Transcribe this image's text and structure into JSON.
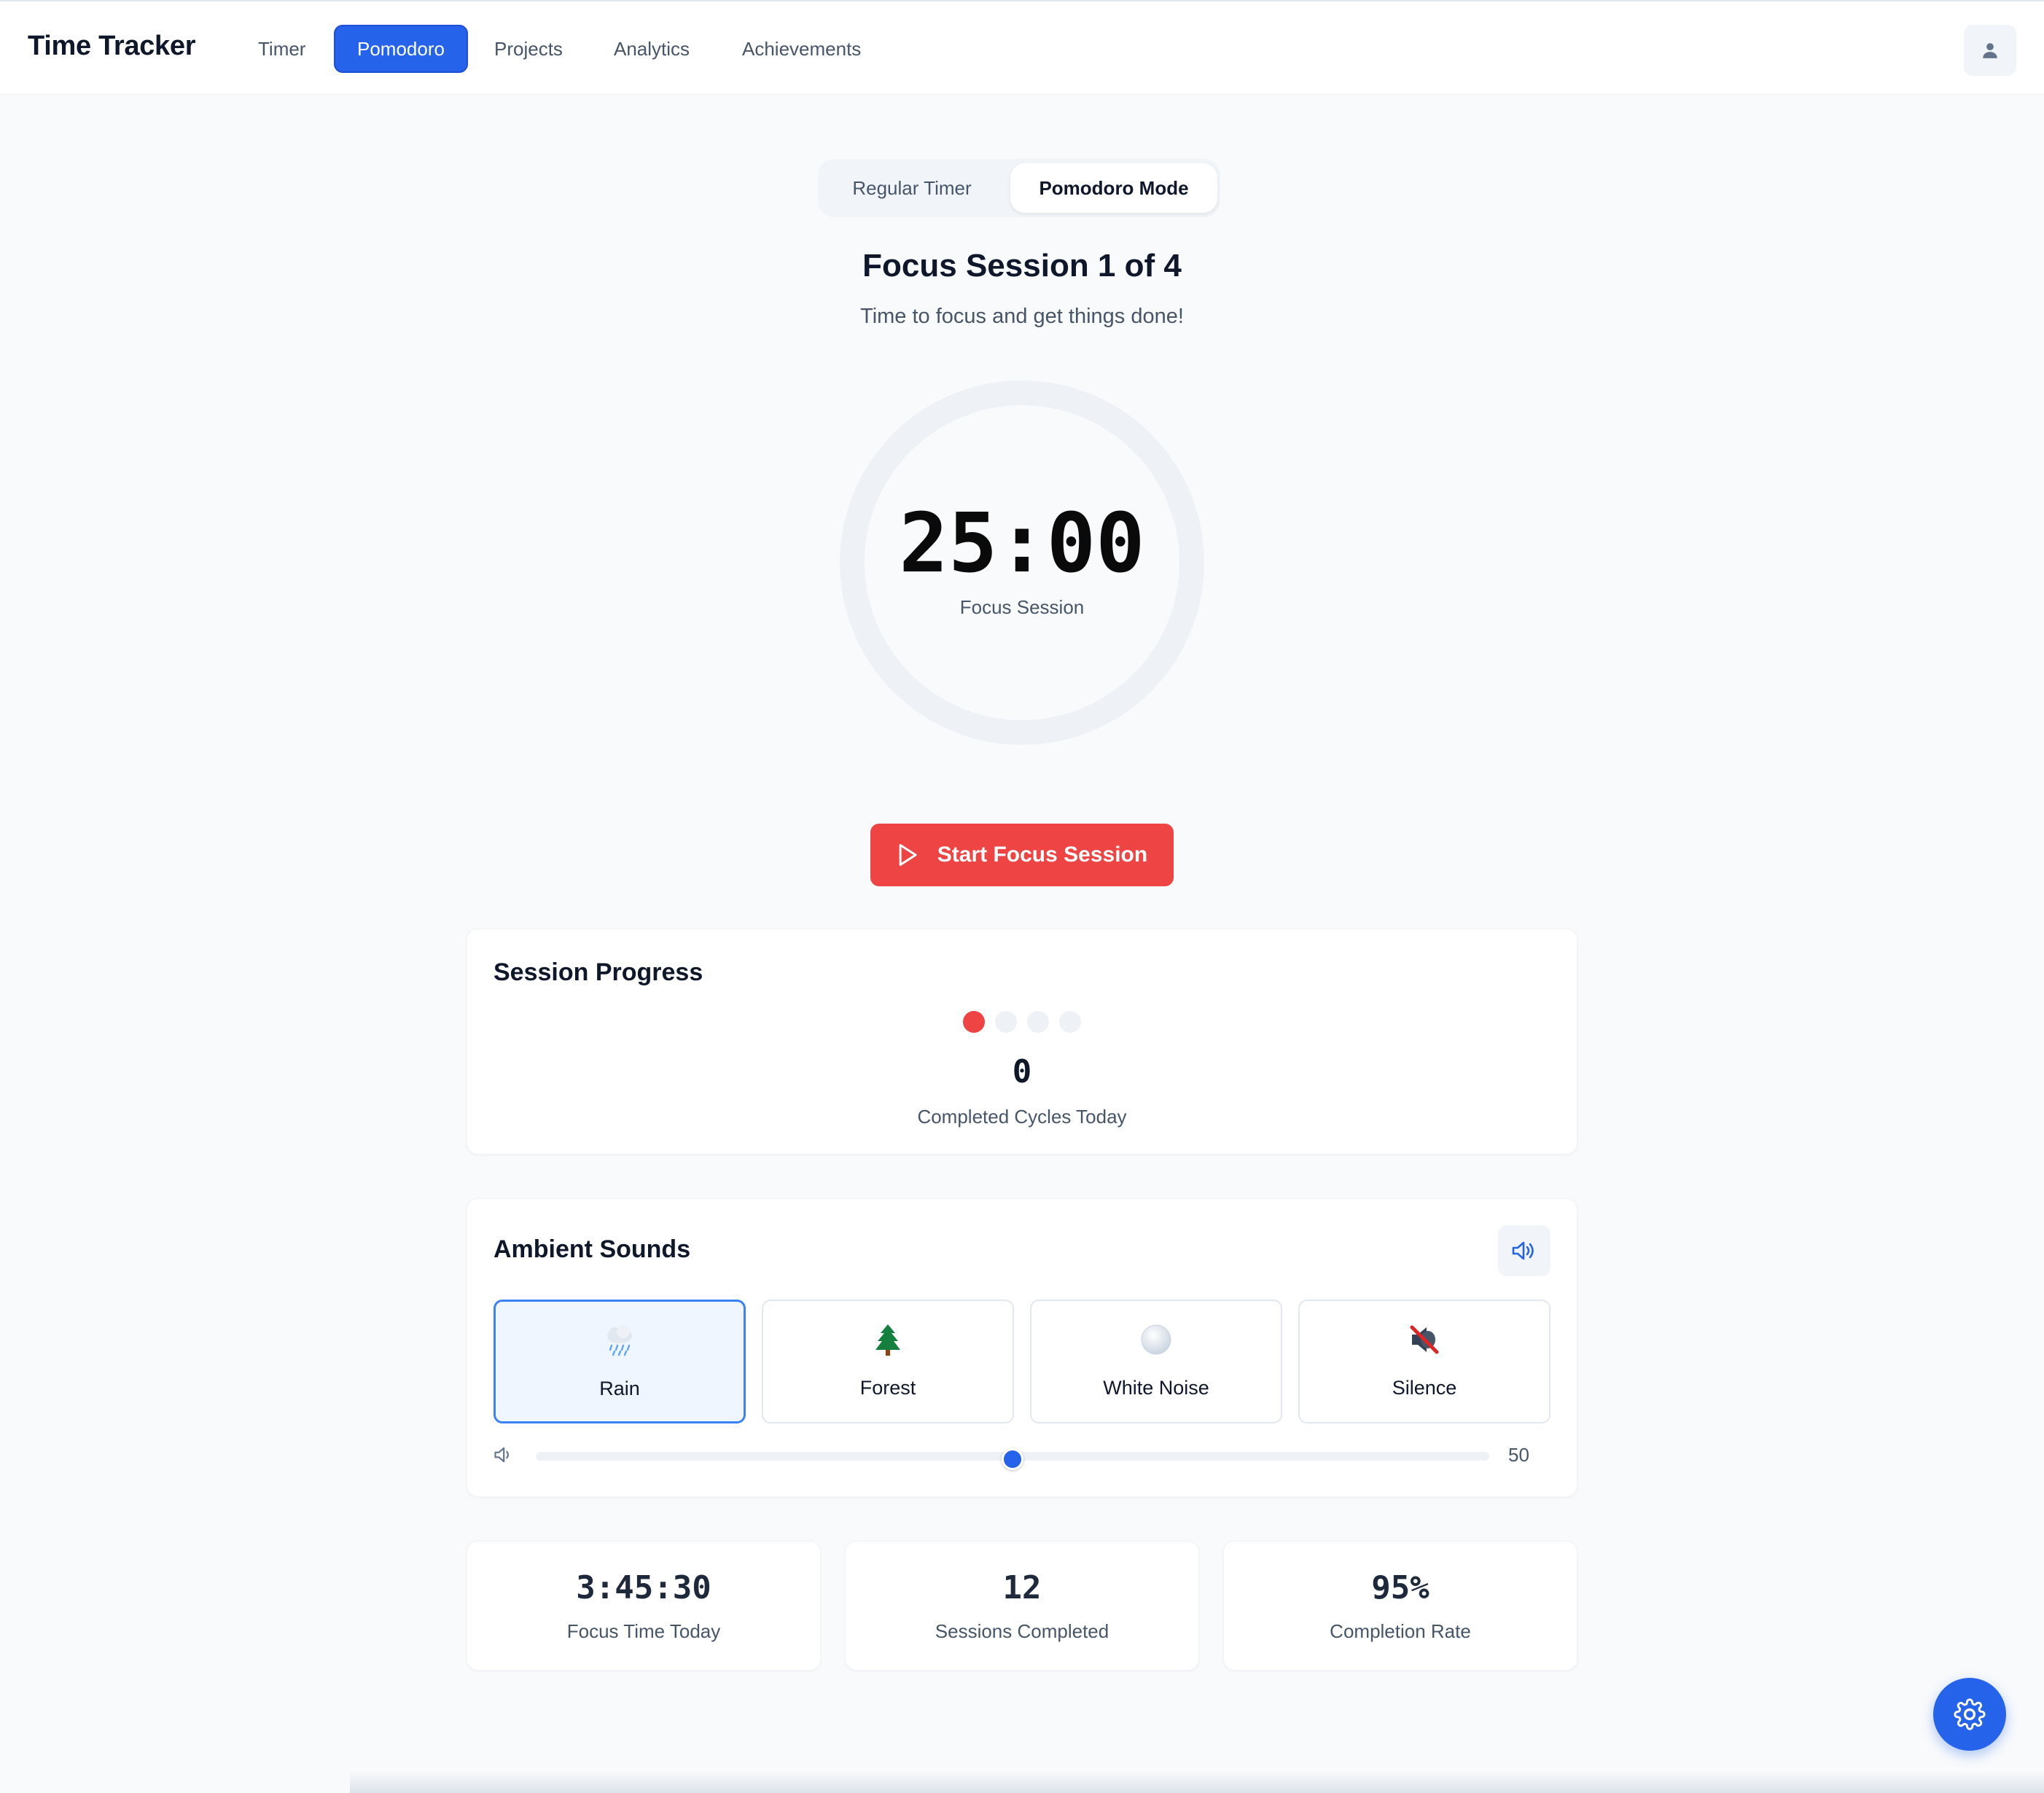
{
  "app": {
    "title": "Time Tracker"
  },
  "nav": {
    "items": [
      {
        "label": "Timer"
      },
      {
        "label": "Pomodoro",
        "active": true
      },
      {
        "label": "Projects"
      },
      {
        "label": "Analytics"
      },
      {
        "label": "Achievements"
      }
    ],
    "user_icon": "user-icon"
  },
  "mode_toggle": {
    "regular": "Regular Timer",
    "pomodoro": "Pomodoro Mode",
    "selected": "pomodoro"
  },
  "session": {
    "title": "Focus Session 1 of 4",
    "subtitle": "Time to focus and get things done!",
    "time": "25:00",
    "label": "Focus Session"
  },
  "start_button": {
    "label": "Start Focus Session",
    "icon": "play-icon"
  },
  "progress": {
    "title": "Session Progress",
    "dots_total": 4,
    "dots_active": 1,
    "completed_cycles": "0",
    "completed_label": "Completed Cycles Today"
  },
  "ambient": {
    "title": "Ambient Sounds",
    "toggle_icon": "volume-icon",
    "options": [
      {
        "label": "Rain",
        "icon": "rain-cloud-icon",
        "selected": true
      },
      {
        "label": "Forest",
        "icon": "tree-icon",
        "selected": false
      },
      {
        "label": "White Noise",
        "icon": "white-circle-icon",
        "selected": false
      },
      {
        "label": "Silence",
        "icon": "muted-speaker-icon",
        "selected": false
      }
    ],
    "volume": {
      "value": "50",
      "min": 0,
      "max": 100
    }
  },
  "stats": [
    {
      "value": "3:45:30",
      "label": "Focus Time Today"
    },
    {
      "value": "12",
      "label": "Sessions Completed"
    },
    {
      "value": "95%",
      "label": "Completion Rate"
    }
  ],
  "fab": {
    "icon": "gear-icon"
  },
  "colors": {
    "primary": "#2563eb",
    "danger": "#ef4444",
    "background": "#f8fafc",
    "muted": "#475569"
  }
}
